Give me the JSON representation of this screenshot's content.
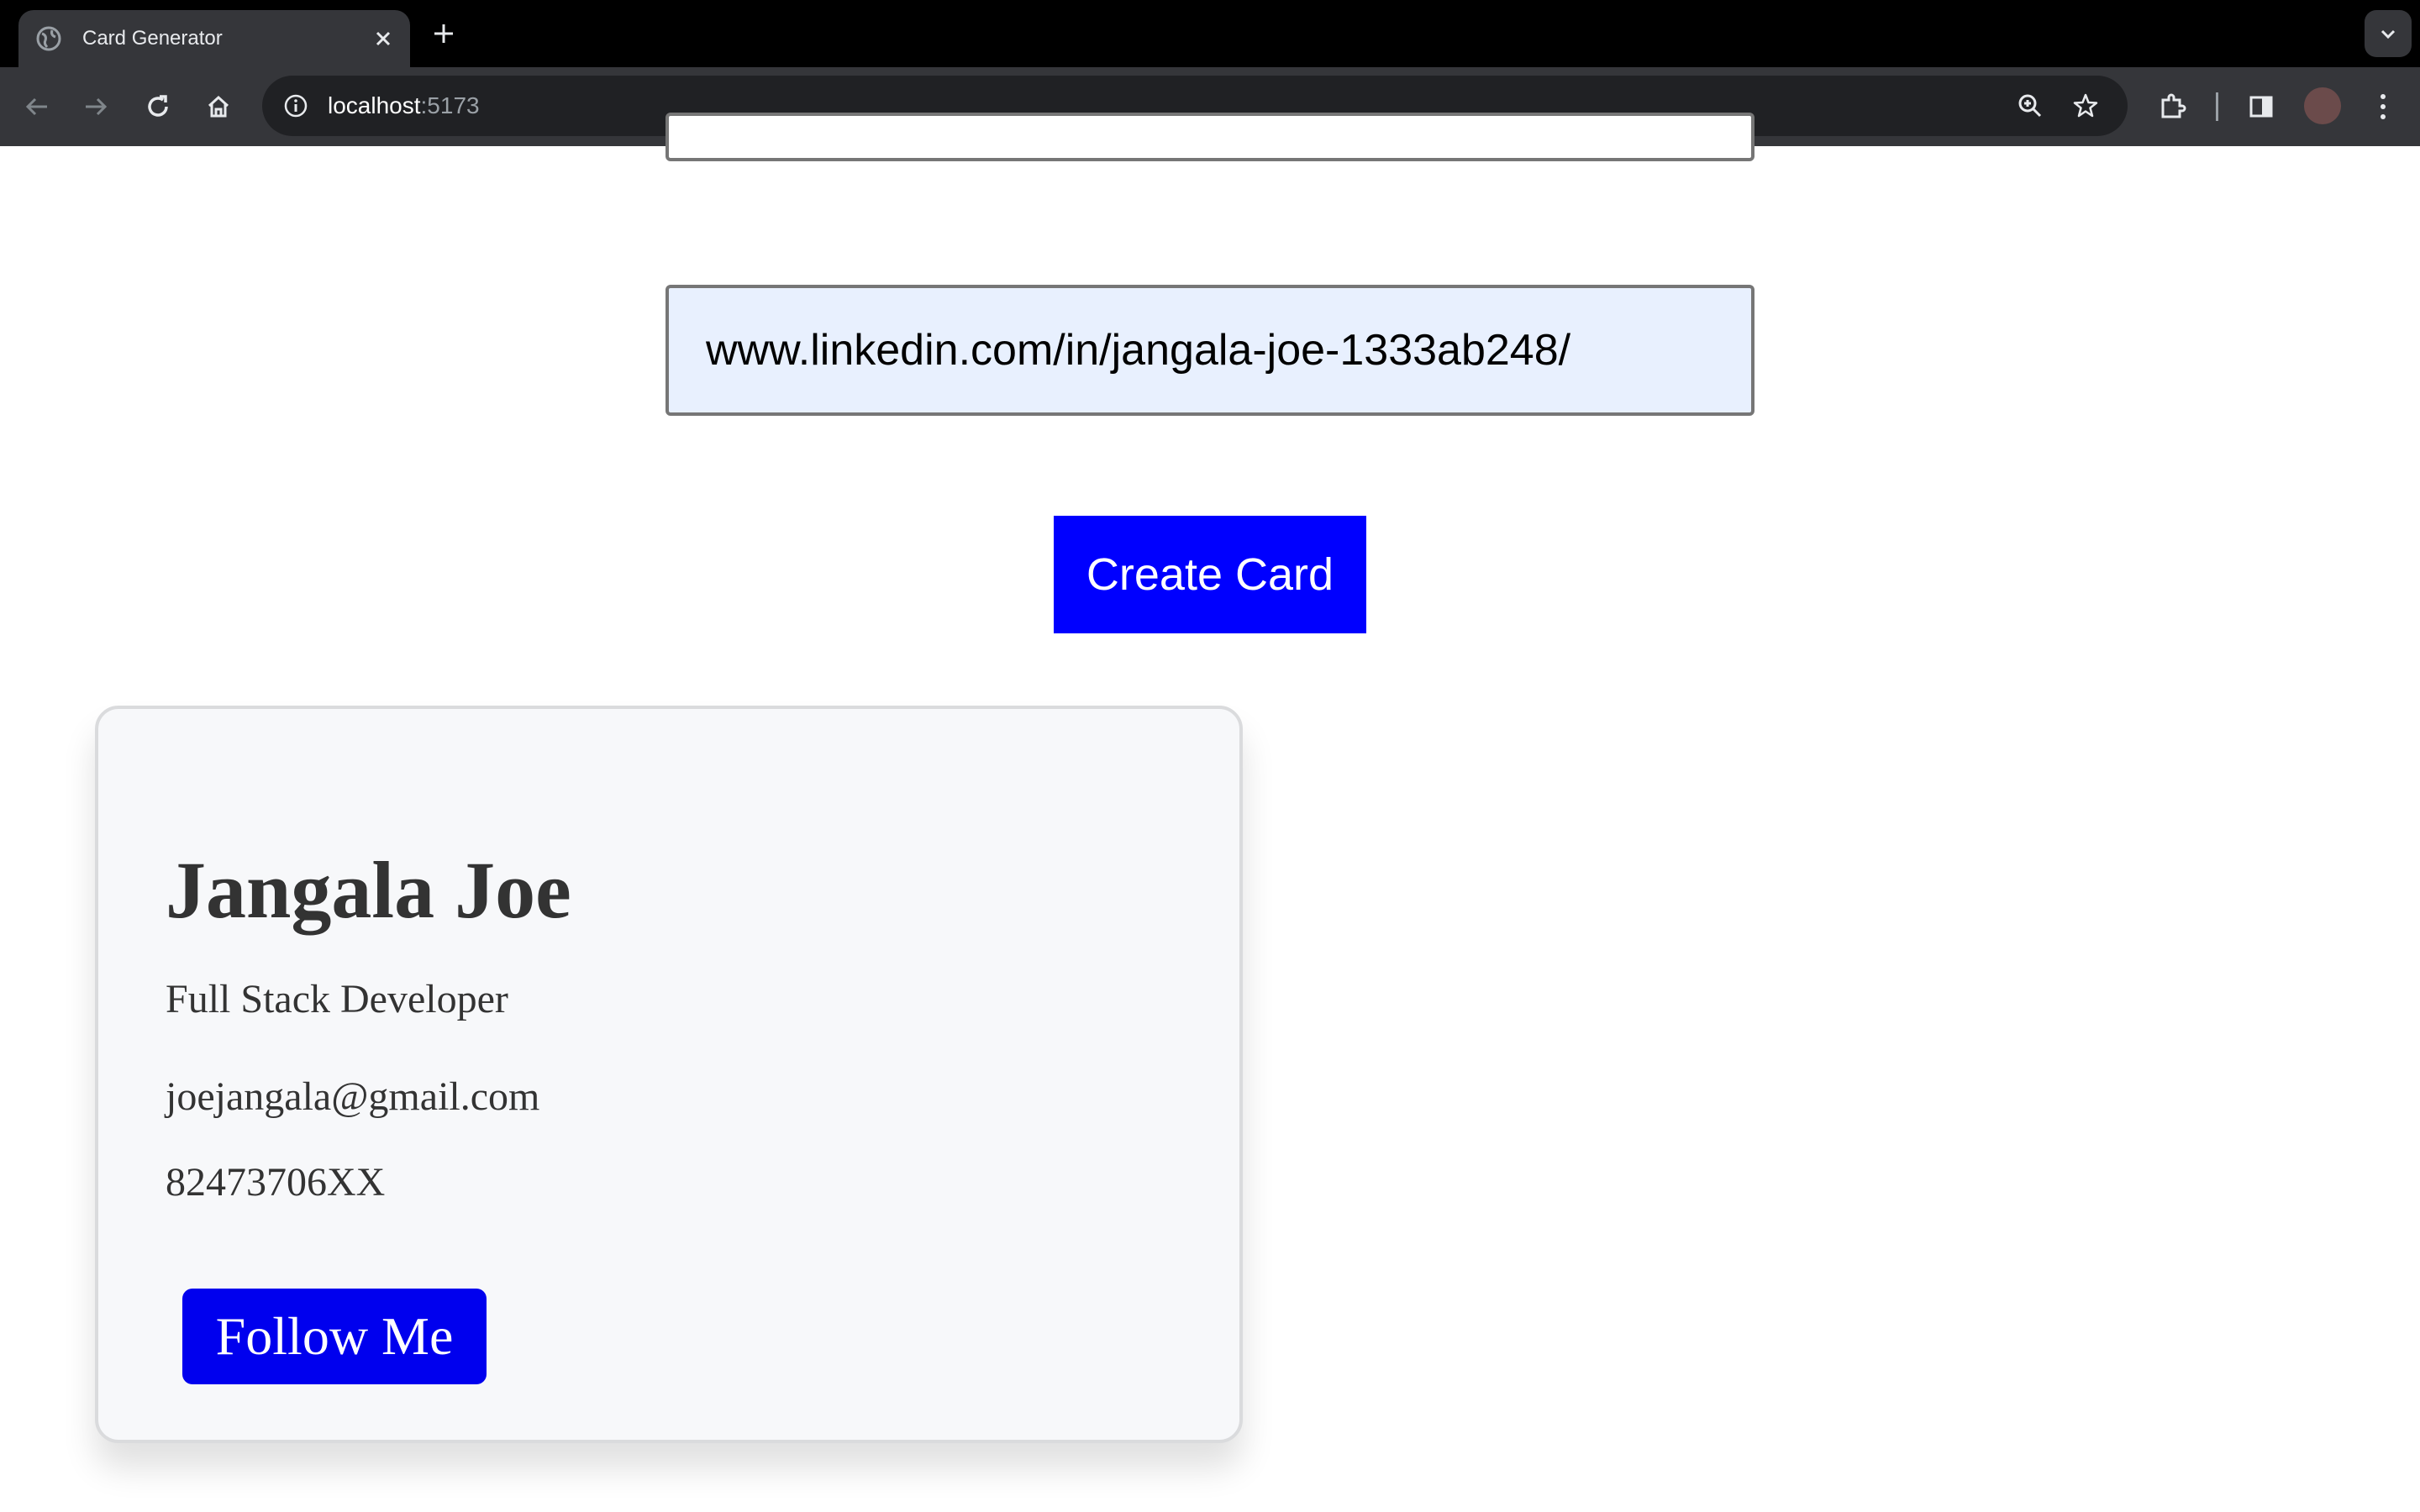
{
  "browser": {
    "tab_title": "Card Generator",
    "url_host": "localhost",
    "url_port": ":5173"
  },
  "form": {
    "linkedin_value": "www.linkedin.com/in/jangala-joe-1333ab248/",
    "create_button_label": "Create Card"
  },
  "card": {
    "name": "Jangala Joe",
    "title": "Full Stack Developer",
    "email": "joejangala@gmail.com",
    "phone": "82473706XX",
    "follow_label": "Follow Me"
  },
  "colors": {
    "accent": "#0000ff",
    "card_background": "#f7f8fa",
    "input_fill": "#e8f0fe"
  }
}
